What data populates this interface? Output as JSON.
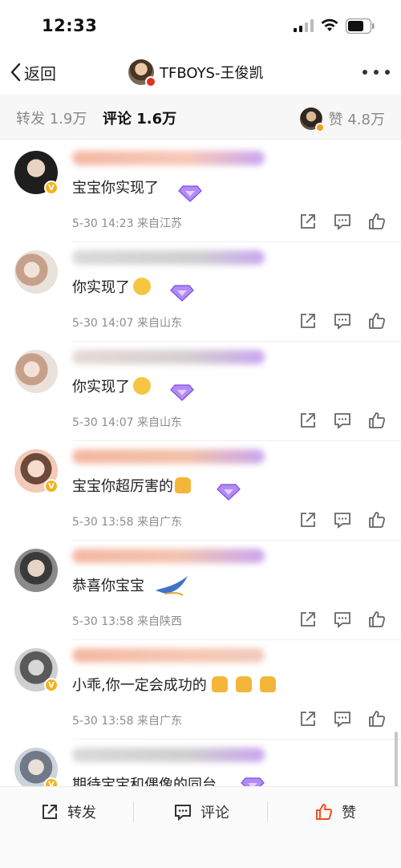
{
  "status_bar": {
    "time": "12:33"
  },
  "nav": {
    "back_label": "返回",
    "title": "TFBOYS-王俊凯"
  },
  "tabs": {
    "repost": "转发 1.9万",
    "comment": "评论 1.6万",
    "like": "赞 4.8万"
  },
  "comments": [
    {
      "text": "宝宝你实现了",
      "meta": "5-30 14:23  来自江苏",
      "avatar_color": "#2b2b2b",
      "name_color": "#f4b7a2",
      "verified": true
    },
    {
      "text": "你实现了",
      "meta": "5-30 14:07  来自山东",
      "avatar_color": "#c9a99a",
      "name_color": "#cfcfcf",
      "verified": false
    },
    {
      "text": "你实现了",
      "meta": "5-30 14:07  来自山东",
      "avatar_color": "#c9a99a",
      "name_color": "#d5cfcf",
      "verified": false
    },
    {
      "text": "宝宝你超厉害的",
      "meta": "5-30 13:58  来自广东",
      "avatar_color": "#e6b09a",
      "name_color": "#f4b7a2",
      "verified": true
    },
    {
      "text": "恭喜你宝宝",
      "meta": "5-30 13:58  来自陕西",
      "avatar_color": "#555555",
      "name_color": "#f4b7a2",
      "verified": false
    },
    {
      "text": "小乖,你一定会成功的",
      "meta": "5-30 13:58  来自广东",
      "avatar_color": "#9a9a9a",
      "name_color": "#f4b7a2",
      "verified": true
    },
    {
      "text": "期待宝宝和偶像的同台",
      "meta": "",
      "avatar_color": "#b8c0c8",
      "name_color": "#cfcfcf",
      "verified": true
    }
  ],
  "toolbar": {
    "repost": "转发",
    "comment": "评论",
    "like": "赞"
  },
  "colors": {
    "like_accent": "#f24f1c",
    "meta_gray": "#8d8d8d",
    "gem_purple": "#9b6bf0"
  }
}
